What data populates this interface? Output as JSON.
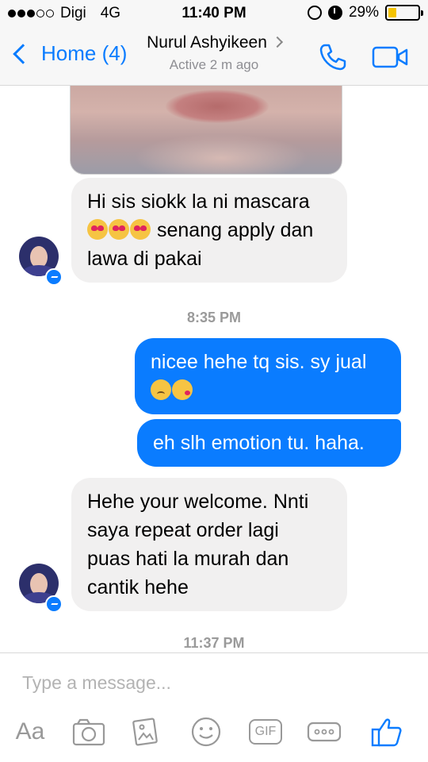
{
  "status_bar": {
    "carrier": "Digi",
    "network": "4G",
    "time": "11:40 PM",
    "battery": "29%",
    "battery_level": 0.29
  },
  "nav": {
    "back_label": "Home (4)",
    "contact_name": "Nurul Ashyikeen",
    "contact_status": "Active 2 m ago"
  },
  "messages": [
    {
      "direction": "incoming",
      "text_parts": [
        "Hi sis siokk la ni mascara",
        "senang apply dan",
        "lawa di pakai"
      ],
      "emojis": [
        "smiling-face-heart-eyes",
        "smiling-face-heart-eyes",
        "smiling-face-heart-eyes"
      ]
    },
    {
      "type": "timestamp",
      "text": "8:35 PM"
    },
    {
      "direction": "outgoing",
      "text": "nicee hehe tq sis. sy jual",
      "emojis": [
        "disappointed-face",
        "face-blowing-kiss"
      ]
    },
    {
      "direction": "outgoing",
      "text": "eh slh emotion tu. haha."
    },
    {
      "direction": "incoming",
      "lines": [
        "Hehe your welcome. Nnti",
        "saya repeat order lagi",
        "puas hati la murah dan",
        "cantik hehe"
      ]
    },
    {
      "type": "timestamp",
      "text": "11:37 PM"
    }
  ],
  "composer": {
    "placeholder": "Type a message...",
    "text_format_label": "Aa",
    "gif_label": "GIF"
  },
  "colors": {
    "accent": "#0a7cff",
    "incoming_bubble": "#f1f0f0",
    "timestamp": "#9a9a9a"
  }
}
